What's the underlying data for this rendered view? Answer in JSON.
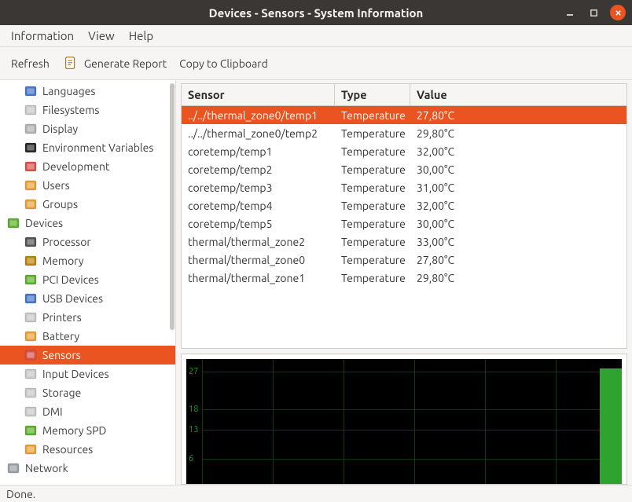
{
  "window": {
    "title": "Devices - Sensors - System Information"
  },
  "menu": {
    "information": "Information",
    "view": "View",
    "help": "Help"
  },
  "toolbar": {
    "refresh": "Refresh",
    "generate_report": "Generate Report",
    "copy": "Copy to Clipboard"
  },
  "sidebar": {
    "items": [
      {
        "label": "Languages",
        "indent": 1,
        "icon": "flag-icon",
        "color": "#4a76c7"
      },
      {
        "label": "Filesystems",
        "indent": 1,
        "icon": "drive-icon",
        "color": "#c7c7c7"
      },
      {
        "label": "Display",
        "indent": 1,
        "icon": "monitor-icon",
        "color": "#b2b2b2"
      },
      {
        "label": "Environment Variables",
        "indent": 1,
        "icon": "terminal-icon",
        "color": "#2a2a2a"
      },
      {
        "label": "Development",
        "indent": 1,
        "icon": "toolbox-icon",
        "color": "#d9534f"
      },
      {
        "label": "Users",
        "indent": 1,
        "icon": "users-icon",
        "color": "#e6a23c"
      },
      {
        "label": "Groups",
        "indent": 1,
        "icon": "users-icon",
        "color": "#e6a23c"
      },
      {
        "label": "Devices",
        "indent": 0,
        "icon": "chip-icon",
        "color": "#5fae2e"
      },
      {
        "label": "Processor",
        "indent": 1,
        "icon": "cpu-icon",
        "color": "#555555"
      },
      {
        "label": "Memory",
        "indent": 1,
        "icon": "ram-icon",
        "color": "#b8860b"
      },
      {
        "label": "PCI Devices",
        "indent": 1,
        "icon": "pci-icon",
        "color": "#5fae2e"
      },
      {
        "label": "USB Devices",
        "indent": 1,
        "icon": "usb-icon",
        "color": "#4a76c7"
      },
      {
        "label": "Printers",
        "indent": 1,
        "icon": "printer-icon",
        "color": "#c7c7c7"
      },
      {
        "label": "Battery",
        "indent": 1,
        "icon": "battery-icon",
        "color": "#e6a23c"
      },
      {
        "label": "Sensors",
        "indent": 1,
        "icon": "thermometer-icon",
        "color": "#d9534f",
        "selected": true
      },
      {
        "label": "Input Devices",
        "indent": 1,
        "icon": "mouse-icon",
        "color": "#c7c7c7"
      },
      {
        "label": "Storage",
        "indent": 1,
        "icon": "hdd-icon",
        "color": "#c7c7c7"
      },
      {
        "label": "DMI",
        "indent": 1,
        "icon": "monitor-icon",
        "color": "#c7c7c7"
      },
      {
        "label": "Memory SPD",
        "indent": 1,
        "icon": "ram-icon",
        "color": "#5fae2e"
      },
      {
        "label": "Resources",
        "indent": 1,
        "icon": "gear-icon",
        "color": "#e6a23c"
      },
      {
        "label": "Network",
        "indent": 0,
        "icon": "network-icon",
        "color": "#9aa0a6"
      }
    ]
  },
  "table": {
    "headers": {
      "sensor": "Sensor",
      "type": "Type",
      "value": "Value"
    },
    "rows": [
      {
        "sensor": "../../thermal_zone0/temp1",
        "type": "Temperature",
        "value": "27,80°C",
        "selected": true
      },
      {
        "sensor": "../../thermal_zone0/temp2",
        "type": "Temperature",
        "value": "29,80°C"
      },
      {
        "sensor": "coretemp/temp1",
        "type": "Temperature",
        "value": "32,00°C"
      },
      {
        "sensor": "coretemp/temp2",
        "type": "Temperature",
        "value": "30,00°C"
      },
      {
        "sensor": "coretemp/temp3",
        "type": "Temperature",
        "value": "31,00°C"
      },
      {
        "sensor": "coretemp/temp4",
        "type": "Temperature",
        "value": "32,00°C"
      },
      {
        "sensor": "coretemp/temp5",
        "type": "Temperature",
        "value": "30,00°C"
      },
      {
        "sensor": "thermal/thermal_zone2",
        "type": "Temperature",
        "value": "33,00°C"
      },
      {
        "sensor": "thermal/thermal_zone0",
        "type": "Temperature",
        "value": "27,80°C"
      },
      {
        "sensor": "thermal/thermal_zone1",
        "type": "Temperature",
        "value": "29,80°C"
      }
    ]
  },
  "chart_data": {
    "type": "line",
    "title": "",
    "xlabel": "",
    "ylabel": "",
    "y_ticks": [
      27,
      18,
      13,
      6
    ],
    "ylim": [
      0,
      30
    ],
    "series": [
      {
        "name": "thermal_zone0/temp1",
        "values": [
          27.8
        ]
      }
    ],
    "grid": true
  },
  "status": {
    "text": "Done."
  },
  "colors": {
    "accent": "#e95420"
  }
}
